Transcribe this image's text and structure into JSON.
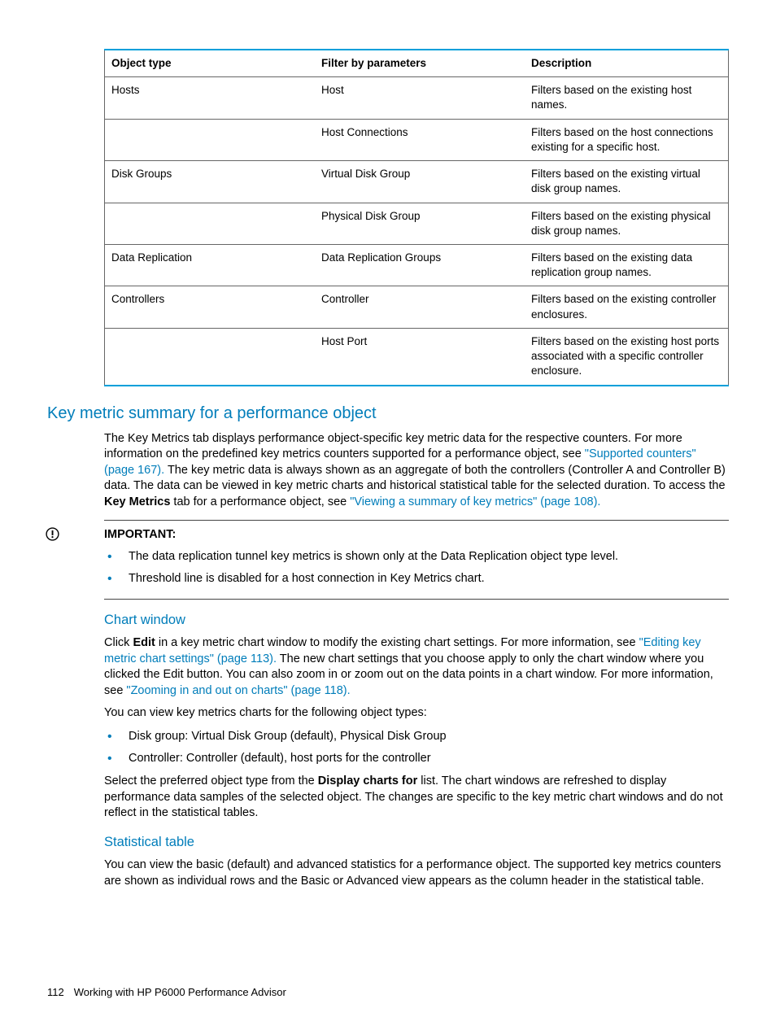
{
  "table": {
    "headers": [
      "Object type",
      "Filter by parameters",
      "Description"
    ],
    "rows": [
      [
        "Hosts",
        "Host",
        "Filters based on the existing host names."
      ],
      [
        "",
        "Host Connections",
        "Filters based on the host connections existing for a specific host."
      ],
      [
        "Disk Groups",
        "Virtual Disk Group",
        "Filters based on the existing virtual disk group names."
      ],
      [
        "",
        "Physical Disk Group",
        "Filters based on the existing physical disk group names."
      ],
      [
        "Data Replication",
        "Data Replication Groups",
        "Filters based on the existing data replication group names."
      ],
      [
        "Controllers",
        "Controller",
        "Filters based on the existing controller enclosures."
      ],
      [
        "",
        "Host Port",
        "Filters based on the existing host ports associated with a specific controller enclosure."
      ]
    ]
  },
  "section": {
    "title": "Key metric summary for a performance object",
    "para1a": "The Key Metrics tab displays performance object-specific key metric data for the respective counters. For more information on the predefined key metrics counters supported for a performance object, see ",
    "link1": "\"Supported counters\" (page 167).",
    "para1b": " The key metric data is always shown as an aggregate of both the controllers (Controller A and Controller B) data. The data can be viewed in key metric charts and historical statistical table for the selected duration. To access the ",
    "bold1": "Key Metrics",
    "para1c": " tab for a performance object, see ",
    "link2": "\"Viewing a summary of key metrics\" (page 108)."
  },
  "important": {
    "label": "IMPORTANT:",
    "items": [
      "The data replication tunnel key metrics is shown only at the Data Replication object type level.",
      "Threshold line is disabled for a host connection in Key Metrics chart."
    ]
  },
  "chartwin": {
    "title": "Chart window",
    "p1a": "Click ",
    "bold1": "Edit",
    "p1b": " in a key metric chart window to modify the existing chart settings. For more information, see ",
    "link1": "\"Editing key metric chart settings\" (page 113).",
    "p1c": " The new chart settings that you choose apply to only the chart window where you clicked the Edit button. You can also zoom in or zoom out on the data points in a chart window. For more information, see ",
    "link2": "\"Zooming in and out on charts\" (page 118).",
    "p2": "You can view key metrics charts for the following object types:",
    "items": [
      "Disk group: Virtual Disk Group (default), Physical Disk Group",
      "Controller: Controller (default), host ports for the controller"
    ],
    "p3a": "Select the preferred object type from the ",
    "bold2": "Display charts for",
    "p3b": " list. The chart windows are refreshed to display performance data samples of the selected object. The changes are specific to the key metric chart windows and do not reflect in the statistical tables."
  },
  "stattab": {
    "title": "Statistical table",
    "p1": "You can view the basic (default) and advanced statistics for a performance object. The supported key metrics counters are shown as individual rows and the Basic or Advanced view appears as the column header in the statistical table."
  },
  "footer": {
    "page": "112",
    "title": "Working with HP P6000 Performance Advisor"
  }
}
